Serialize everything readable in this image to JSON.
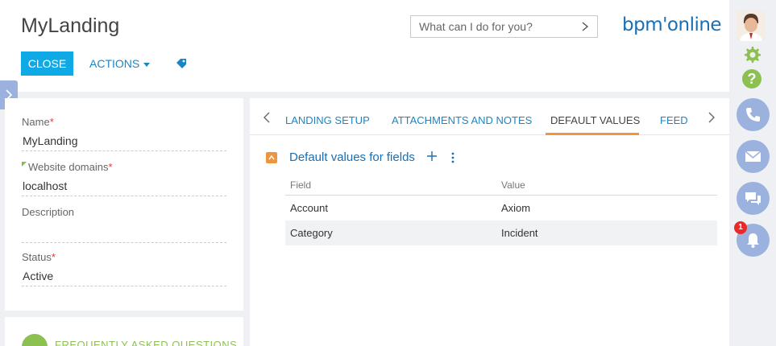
{
  "header": {
    "title": "MyLanding",
    "close_label": "CLOSE",
    "actions_label": "ACTIONS",
    "search_placeholder": "What can I do for you?",
    "logo_text": "bpm'online"
  },
  "form": {
    "name_label": "Name",
    "name_value": "MyLanding",
    "domains_label": "Website domains",
    "domains_value": "localhost",
    "description_label": "Description",
    "description_value": "",
    "status_label": "Status",
    "status_value": "Active",
    "required_mark": "*"
  },
  "faq": {
    "label": "FREQUENTLY ASKED QUESTIONS"
  },
  "tabs": [
    {
      "label": "LANDING SETUP"
    },
    {
      "label": "ATTACHMENTS AND NOTES"
    },
    {
      "label": "DEFAULT VALUES"
    },
    {
      "label": "FEED"
    }
  ],
  "section": {
    "title": "Default values for fields",
    "columns": {
      "field": "Field",
      "value": "Value"
    },
    "rows": [
      {
        "field": "Account",
        "value": "Axiom"
      },
      {
        "field": "Category",
        "value": "Incident"
      }
    ]
  },
  "rail": {
    "notification_count": "1"
  },
  "colors": {
    "primary": "#0fa9e6",
    "link": "#1a86c6",
    "accent": "#f0953f",
    "green": "#8cc152",
    "rail_button": "#9ab2dd",
    "badge": "#e82a2a"
  },
  "icons": [
    "chevron-right-icon",
    "tag-icon",
    "user-avatar",
    "gear-icon",
    "help-icon",
    "phone-icon",
    "mail-icon",
    "chat-icon",
    "bell-icon",
    "plus-icon",
    "more-vertical-icon",
    "chevron-up-icon",
    "chevron-left-icon"
  ]
}
